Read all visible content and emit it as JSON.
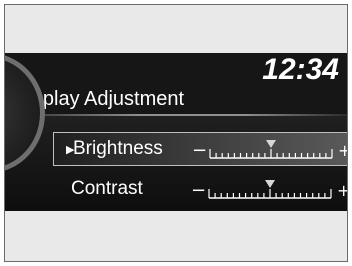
{
  "status_bar": {
    "clock": "12:34"
  },
  "screen": {
    "title": "Display Adjustment"
  },
  "settings": [
    {
      "label": "Brightness",
      "selected": true,
      "level": 0.5,
      "minus": "−",
      "plus": "+"
    },
    {
      "label": "Contrast",
      "selected": false,
      "level": 0.5,
      "minus": "−",
      "plus": "+"
    }
  ],
  "colors": {
    "screen_bg": "#161616",
    "highlight_border": "#bfbfbf",
    "frame_bg": "#e9e9e9",
    "text": "#ffffff"
  },
  "icons": {
    "selection_arrow": "play-right-icon",
    "knob": "dial-arc-icon"
  }
}
